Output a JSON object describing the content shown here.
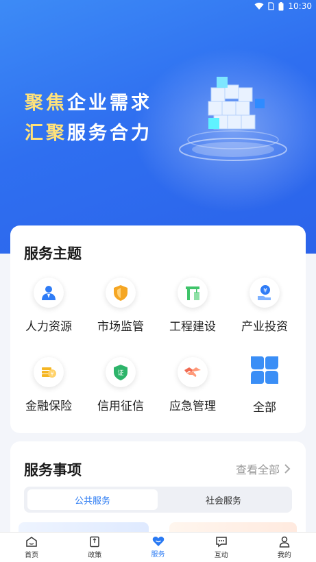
{
  "status_bar": {
    "time": "10:30"
  },
  "hero": {
    "slogan_line1_hl": "聚焦",
    "slogan_line1_rest": "企业需求",
    "slogan_line2_hl": "汇聚",
    "slogan_line2_rest": "服务合力"
  },
  "theme_section": {
    "title": "服务主题",
    "items": [
      {
        "label": "人力资源",
        "icon": "person-icon",
        "color": "#2f7cf6"
      },
      {
        "label": "市场监管",
        "icon": "shield-icon",
        "color": "#f5a623"
      },
      {
        "label": "工程建设",
        "icon": "crane-icon",
        "color": "#3fc46a"
      },
      {
        "label": "产业投资",
        "icon": "coin-hand-icon",
        "color": "#2f7cf6"
      },
      {
        "label": "金融保险",
        "icon": "money-icon",
        "color": "#f5b623"
      },
      {
        "label": "信用征信",
        "icon": "credit-shield-icon",
        "color": "#2db46a"
      },
      {
        "label": "应急管理",
        "icon": "handshake-icon",
        "color": "#f06a52"
      },
      {
        "label": "全部",
        "icon": "grid-icon",
        "color": "#3a8ef6"
      }
    ]
  },
  "items_section": {
    "title": "服务事项",
    "view_all": "查看全部",
    "tabs": [
      {
        "label": "公共服务",
        "active": true
      },
      {
        "label": "社会服务",
        "active": false
      }
    ]
  },
  "bottom_nav": [
    {
      "label": "首页",
      "icon": "home-icon",
      "active": false
    },
    {
      "label": "政策",
      "icon": "policy-icon",
      "active": false
    },
    {
      "label": "服务",
      "icon": "heart-icon",
      "active": true
    },
    {
      "label": "互动",
      "icon": "chat-icon",
      "active": false
    },
    {
      "label": "我的",
      "icon": "user-icon",
      "active": false
    }
  ]
}
